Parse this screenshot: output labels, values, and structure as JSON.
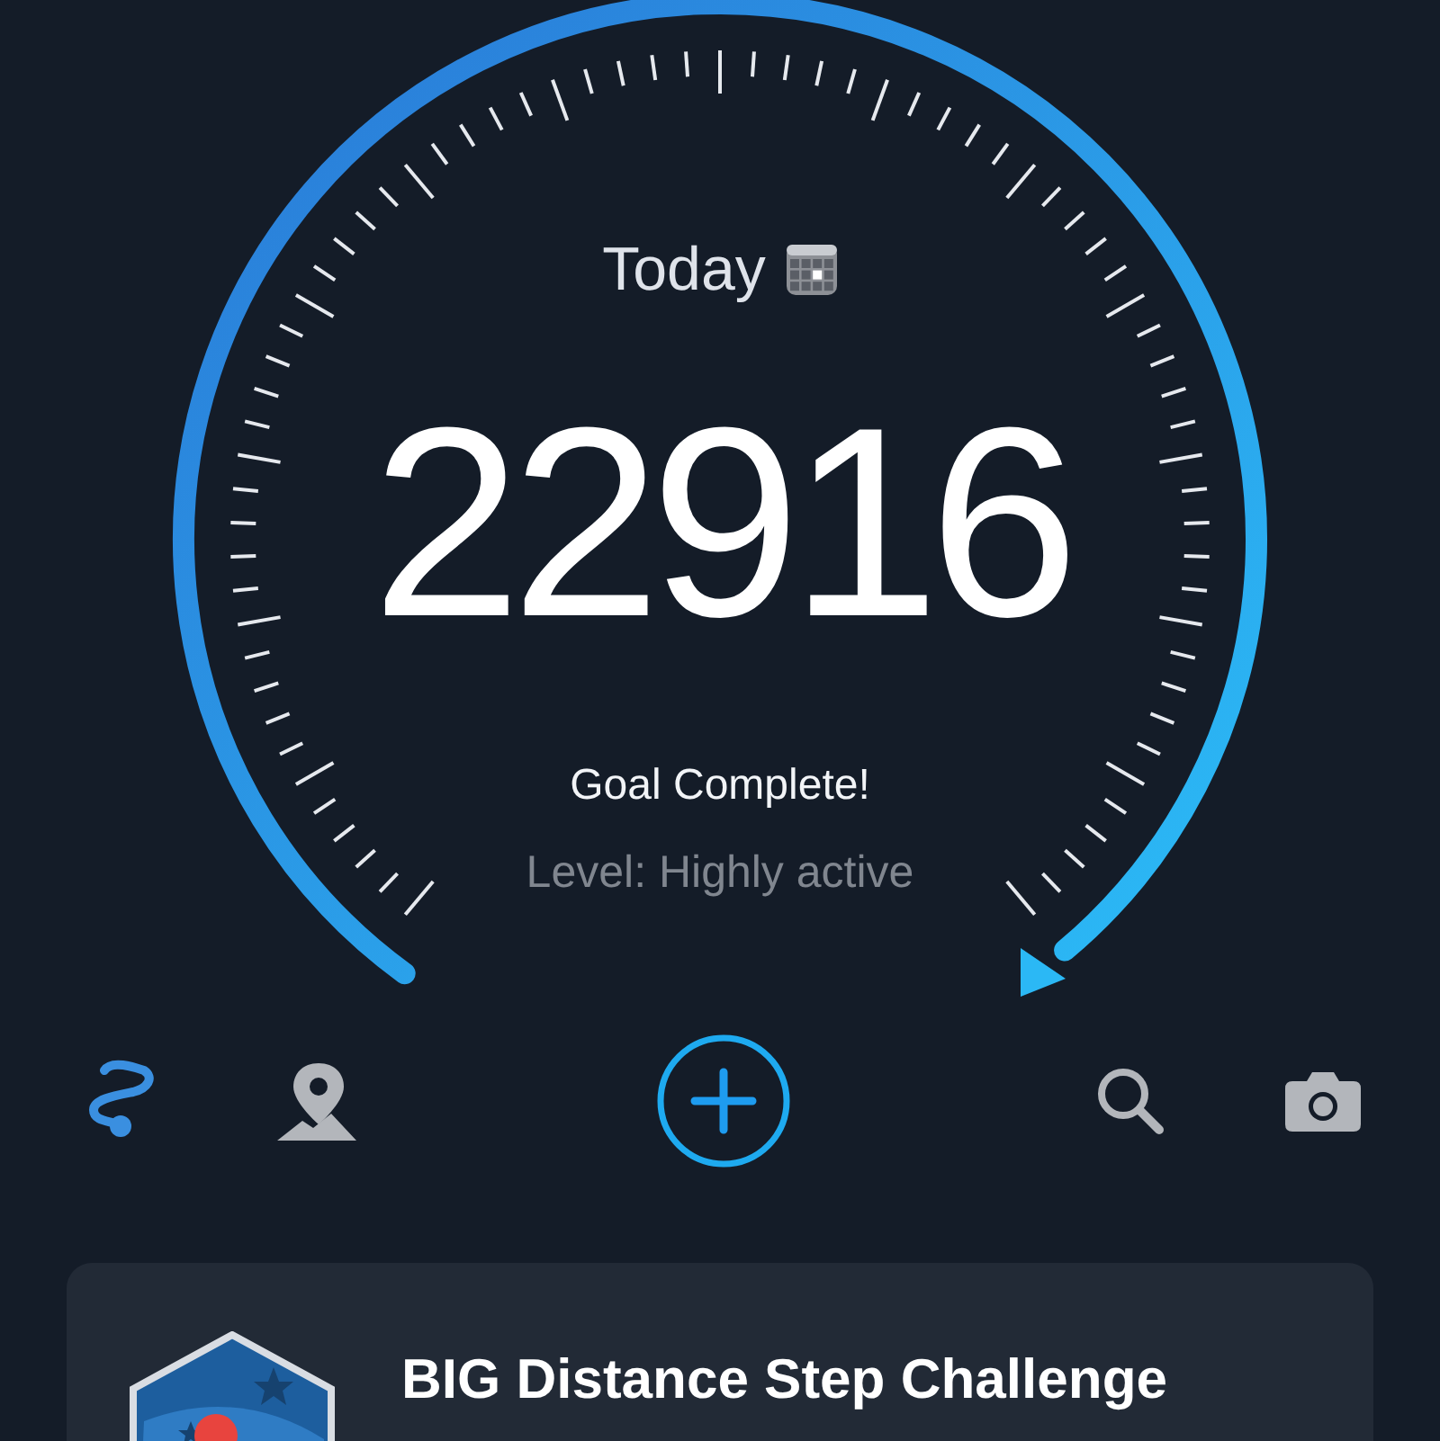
{
  "gauge": {
    "date_label": "Today",
    "steps": "22916",
    "status": "Goal Complete!",
    "level_text": "Level: Highly active"
  },
  "challenge_card": {
    "title": "BIG Distance Step Challenge"
  }
}
